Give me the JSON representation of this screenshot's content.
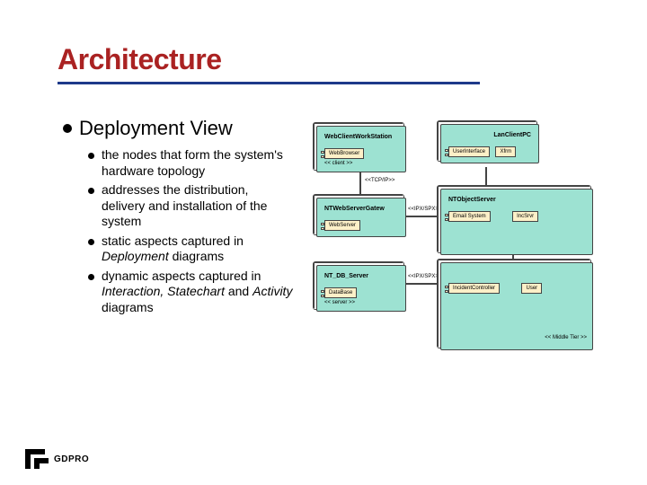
{
  "slide": {
    "title": "Architecture",
    "heading": "Deployment View",
    "bullets": [
      {
        "plain": "the nodes that form the system's hardware topology"
      },
      {
        "plain": "addresses the distribution, delivery and installation of the system"
      },
      {
        "pre": "static aspects captured in ",
        "em": "Deployment",
        "post": " diagrams"
      },
      {
        "pre": "dynamic aspects captured in ",
        "em": "Interaction, Statechart",
        "mid": " and ",
        "em2": "Activity",
        "post": " diagrams"
      }
    ]
  },
  "diagram": {
    "nodes": {
      "n1": {
        "title": "WebClientWorkStation",
        "box": "WebBrowser",
        "sub": "<< client >>"
      },
      "n2": {
        "title": "",
        "box1": "UserInterface",
        "box2": "Xfrm",
        "note": "LanClientPC"
      },
      "n3": {
        "title": "NTWebServerGatew",
        "box": "WebServer"
      },
      "n4": {
        "title": "NTObjectServer",
        "box1": "Email System",
        "box2": "IncSrvr"
      },
      "n5": {
        "title": "NT_DB_Server",
        "box": "DataBase",
        "sub": "<< server >>"
      },
      "big": {
        "box1": "IncidentController",
        "box2": "User",
        "label": "<< Middle Tier >>"
      }
    },
    "labels": {
      "l1": "<<TCP/IP>>",
      "l2": "<<IPX/SPX>>",
      "l3": "<<IPX/SPX>>"
    }
  },
  "footer": {
    "logo_text": "GDPRO"
  }
}
